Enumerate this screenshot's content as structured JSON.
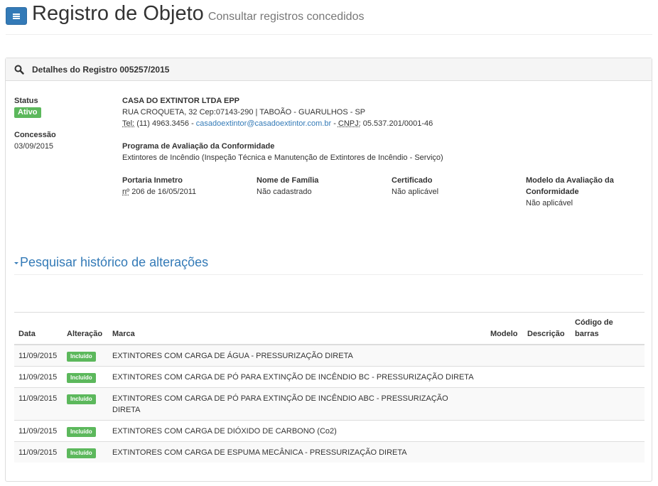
{
  "header": {
    "title": "Registro de Objeto",
    "subtitle": "Consultar registros concedidos"
  },
  "panel": {
    "heading": "Detalhes do Registro 005257/2015"
  },
  "status": {
    "label": "Status",
    "value": "Ativo",
    "value_color": "#5cb85c"
  },
  "concessao": {
    "label": "Concessão",
    "date": "03/09/2015"
  },
  "company": {
    "name": "CASA DO EXTINTOR LTDA EPP",
    "address": "RUA CROQUETA, 32 Cep:07143-290 | TABOÃO - GUARULHOS - SP",
    "tel_label": "Tel:",
    "tel": "(11) 4963.3456",
    "sep1": "-",
    "email": "casadoextintor@casadoextintor.com.br",
    "sep2": "-",
    "cnpj_label": "CNPJ:",
    "cnpj": "05.537.201/0001-46"
  },
  "programa": {
    "label": "Programa de Avaliação da Conformidade",
    "value": "Extintores de Incêndio (Inspeção Técnica e Manutenção de Extintores de Incêndio - Serviço)"
  },
  "details": {
    "portaria_label": "Portaria Inmetro",
    "portaria_abbr": "nº",
    "portaria_value": "206 de 16/05/2011",
    "familia_label": "Nome de Família",
    "familia_value": "Não cadastrado",
    "certificado_label": "Certificado",
    "certificado_value": "Não aplicável",
    "modelo_label_line1": "Modelo da Avaliação da",
    "modelo_label_line2": "Conformidade",
    "modelo_value": "Não aplicável"
  },
  "history": {
    "link_text": "Pesquisar histórico de alterações"
  },
  "table": {
    "headers": {
      "data": "Data",
      "alteracao": "Alteração",
      "marca": "Marca",
      "modelo": "Modelo",
      "descricao": "Descrição",
      "codigo_line1": "Código de",
      "codigo_line2": "barras"
    },
    "rows": [
      {
        "data": "11/09/2015",
        "alteracao": "Incluído",
        "marca": "EXTINTORES COM CARGA DE ÁGUA - PRESSURIZAÇÃO DIRETA",
        "modelo": "",
        "descricao": "",
        "codigo": ""
      },
      {
        "data": "11/09/2015",
        "alteracao": "Incluído",
        "marca": "EXTINTORES COM CARGA DE PÓ PARA EXTINÇÃO DE INCÊNDIO BC - PRESSURIZAÇÃO DIRETA",
        "modelo": "",
        "descricao": "",
        "codigo": ""
      },
      {
        "data": "11/09/2015",
        "alteracao": "Incluído",
        "marca": "EXTINTORES COM CARGA DE PÓ PARA EXTINÇÃO DE INCÊNDIO ABC - PRESSURIZAÇÃO DIRETA",
        "modelo": "",
        "descricao": "",
        "codigo": ""
      },
      {
        "data": "11/09/2015",
        "alteracao": "Incluído",
        "marca": "EXTINTORES COM CARGA DE DIÓXIDO DE CARBONO (Co2)",
        "modelo": "",
        "descricao": "",
        "codigo": ""
      },
      {
        "data": "11/09/2015",
        "alteracao": "Incluído",
        "marca": "EXTINTORES COM CARGA DE ESPUMA MECÂNICA - PRESSURIZAÇÃO DIRETA",
        "modelo": "",
        "descricao": "",
        "codigo": ""
      }
    ]
  },
  "icons": {
    "menu": "hamburger-icon",
    "search": "search-icon",
    "caret": "caret-down-icon"
  },
  "colors": {
    "primary": "#337ab7",
    "success": "#5cb85c"
  }
}
